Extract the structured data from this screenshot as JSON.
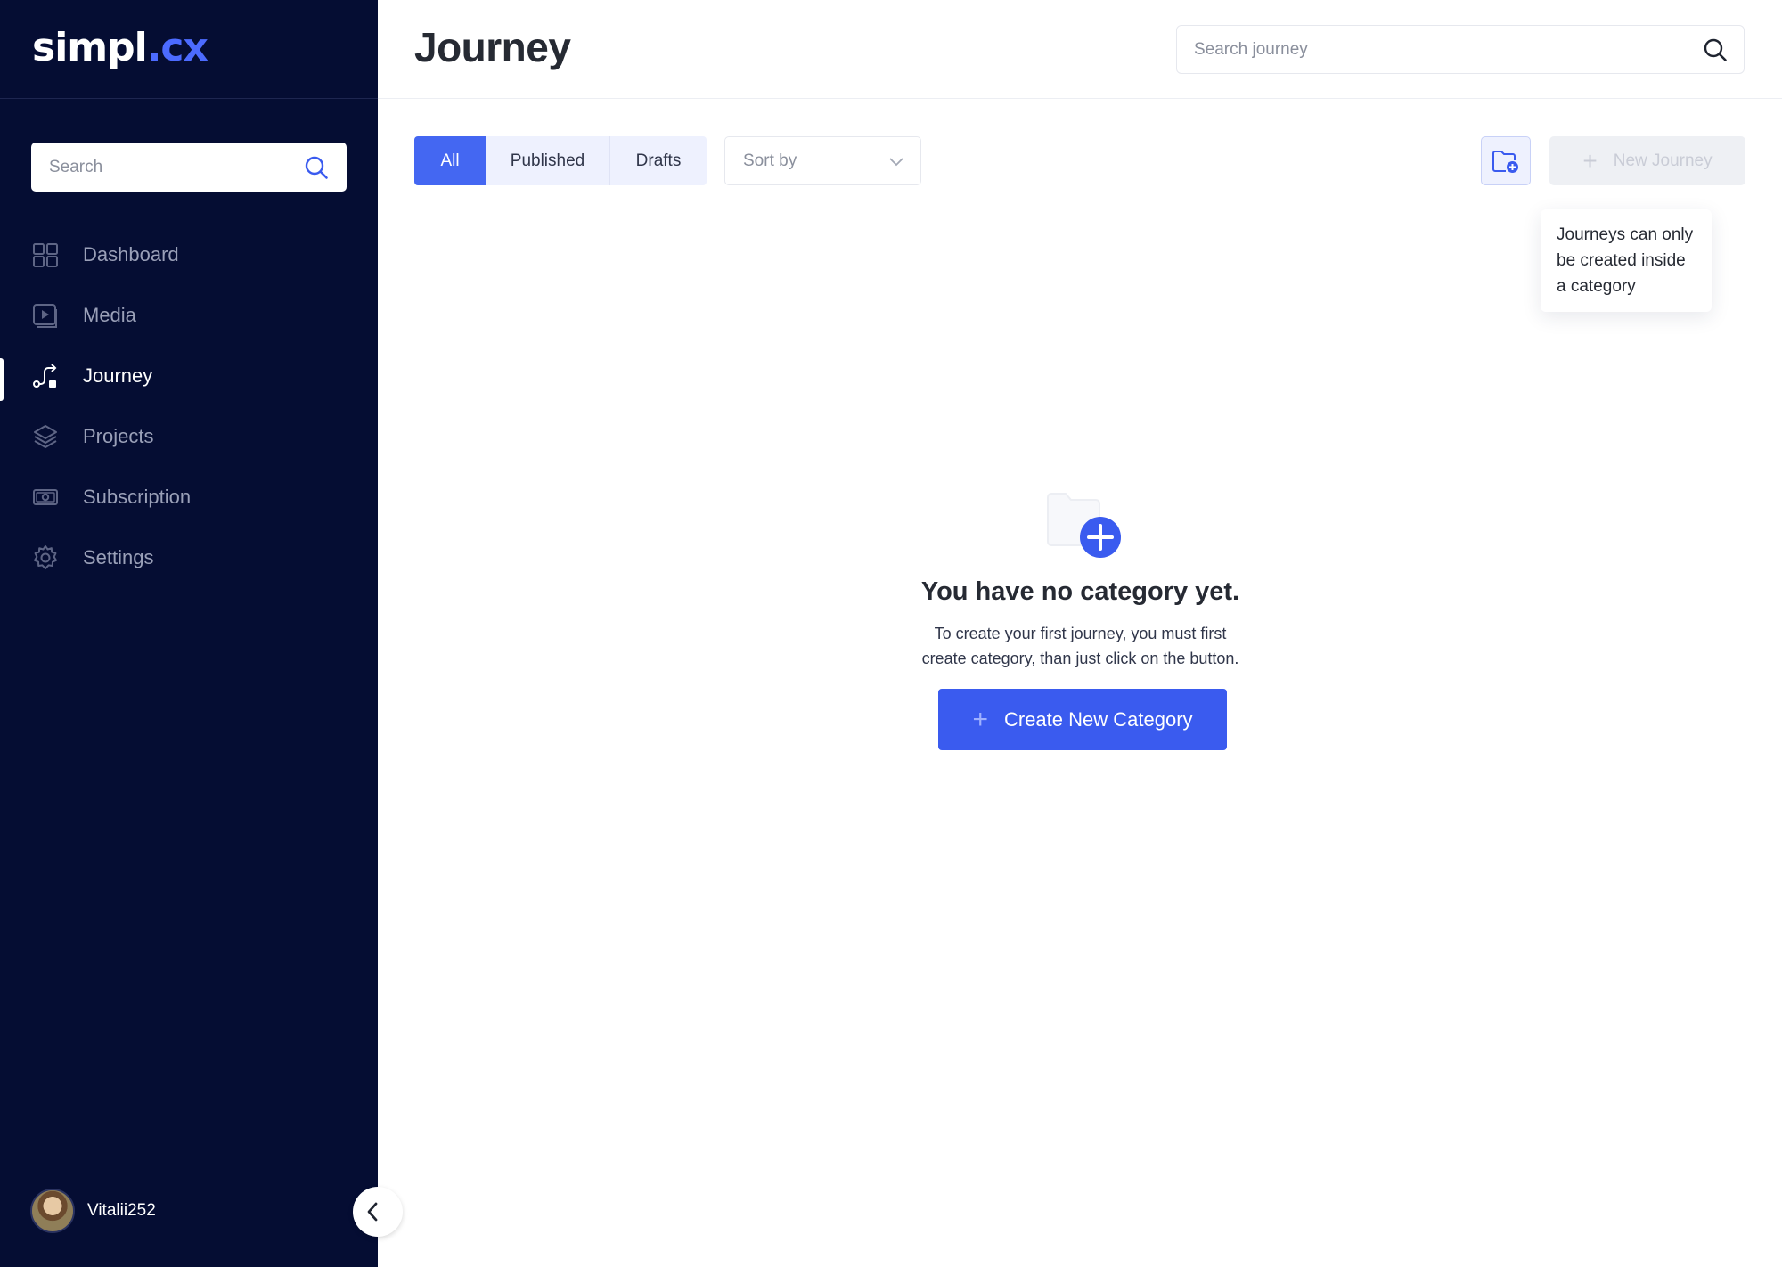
{
  "brand": {
    "name_main": "simpl",
    "name_dot": ".",
    "name_ext": "cx",
    "accent_color": "#4467f2",
    "sidebar_bg": "#050d33"
  },
  "sidebar": {
    "search": {
      "placeholder": "Search"
    },
    "items": [
      {
        "label": "Dashboard",
        "icon": "dashboard-icon",
        "active": false
      },
      {
        "label": "Media",
        "icon": "media-play-icon",
        "active": false
      },
      {
        "label": "Journey",
        "icon": "journey-route-icon",
        "active": true
      },
      {
        "label": "Projects",
        "icon": "layers-icon",
        "active": false
      },
      {
        "label": "Subscription",
        "icon": "money-icon",
        "active": false
      },
      {
        "label": "Settings",
        "icon": "gear-icon",
        "active": false
      }
    ],
    "user": {
      "name": "Vitalii252"
    }
  },
  "header": {
    "title": "Journey",
    "search": {
      "placeholder": "Search journey"
    }
  },
  "filters": {
    "tabs": [
      {
        "label": "All",
        "active": true
      },
      {
        "label": "Published",
        "active": false
      },
      {
        "label": "Drafts",
        "active": false
      }
    ],
    "sort": {
      "placeholder": "Sort by"
    }
  },
  "actions": {
    "new_journey_label": "New Journey",
    "tooltip": "Journeys can only be created inside a category"
  },
  "empty_state": {
    "title": "You have no category yet.",
    "description": "To create your first journey, you must first create category, than just click on the button.",
    "button_label": "Create New Category"
  }
}
